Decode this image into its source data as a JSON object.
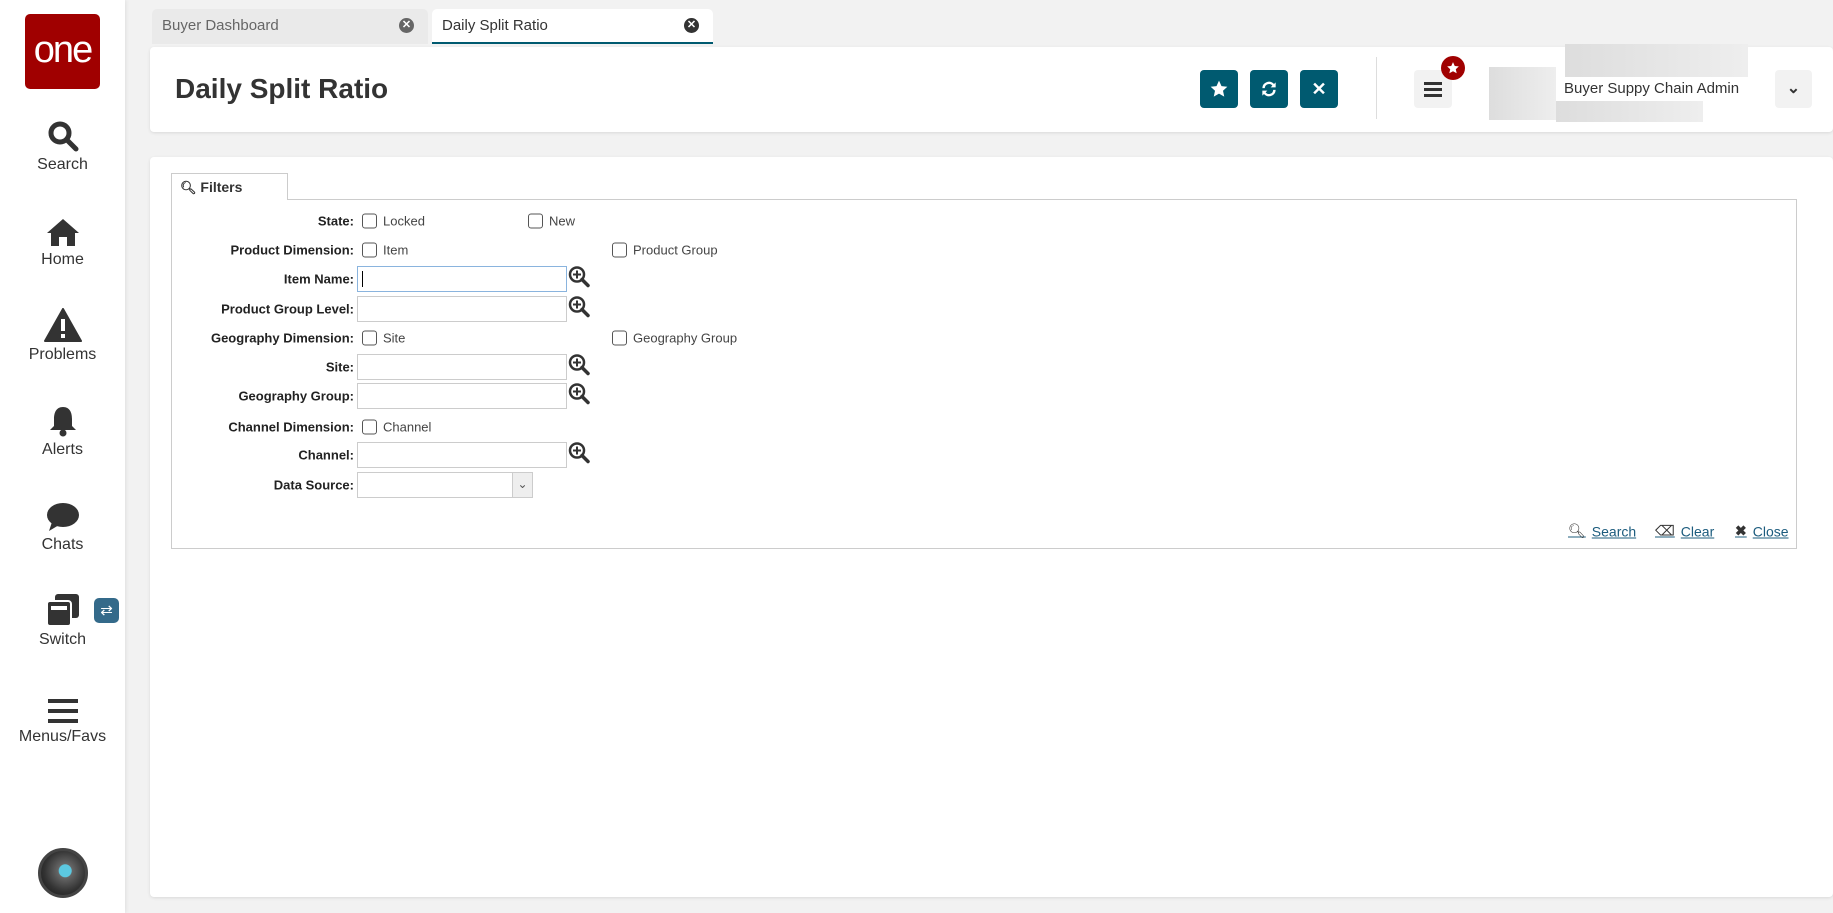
{
  "logo": "one",
  "sidebar": {
    "items": [
      {
        "label": "Search",
        "icon": "search-icon"
      },
      {
        "label": "Home",
        "icon": "home-icon"
      },
      {
        "label": "Problems",
        "icon": "warning-icon"
      },
      {
        "label": "Alerts",
        "icon": "bell-icon"
      },
      {
        "label": "Chats",
        "icon": "chat-icon"
      },
      {
        "label": "Switch",
        "icon": "switch-icon"
      },
      {
        "label": "Menus/Favs",
        "icon": "menu-icon"
      }
    ]
  },
  "tabs": [
    {
      "label": "Buyer Dashboard",
      "active": false
    },
    {
      "label": "Daily Split Ratio",
      "active": true
    }
  ],
  "header": {
    "title": "Daily Split Ratio",
    "user_role": "Buyer Suppy Chain Admin"
  },
  "colors": {
    "brand": "#a00000",
    "accent": "#005a70",
    "link": "#1c5c7e"
  },
  "filters": {
    "tab_label": "Filters",
    "labels": {
      "state": "State:",
      "product_dimension": "Product Dimension:",
      "item_name": "Item Name:",
      "product_group_level": "Product Group Level:",
      "geography_dimension": "Geography Dimension:",
      "site": "Site:",
      "geography_group": "Geography Group:",
      "channel_dimension": "Channel Dimension:",
      "channel": "Channel:",
      "data_source": "Data Source:"
    },
    "checkboxes": {
      "locked": "Locked",
      "new": "New",
      "item": "Item",
      "product_group": "Product Group",
      "site": "Site",
      "geography_group": "Geography Group",
      "channel": "Channel"
    },
    "actions": {
      "search": "Search",
      "clear": "Clear",
      "close": "Close"
    }
  }
}
